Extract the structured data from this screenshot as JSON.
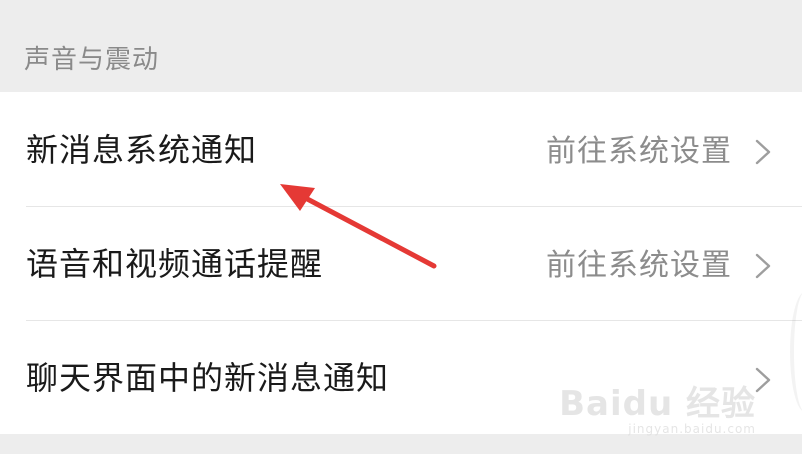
{
  "section": {
    "title": "声音与震动"
  },
  "items": [
    {
      "label": "新消息系统通知",
      "value": "前往系统设置",
      "chevron_icon": "chevron-right-icon"
    },
    {
      "label": "语音和视频通话提醒",
      "value": "前往系统设置",
      "chevron_icon": "chevron-right-icon"
    },
    {
      "label": "聊天界面中的新消息通知",
      "value": "",
      "chevron_icon": "chevron-right-icon"
    }
  ],
  "watermark": {
    "logo": "Baidu 经验",
    "sub": "jingyan.baidu.com"
  },
  "colors": {
    "background": "#ededed",
    "list_background": "#ffffff",
    "label_text": "#1a1a1a",
    "secondary_text": "#8c8c8c",
    "annotation_arrow": "#e53935"
  }
}
